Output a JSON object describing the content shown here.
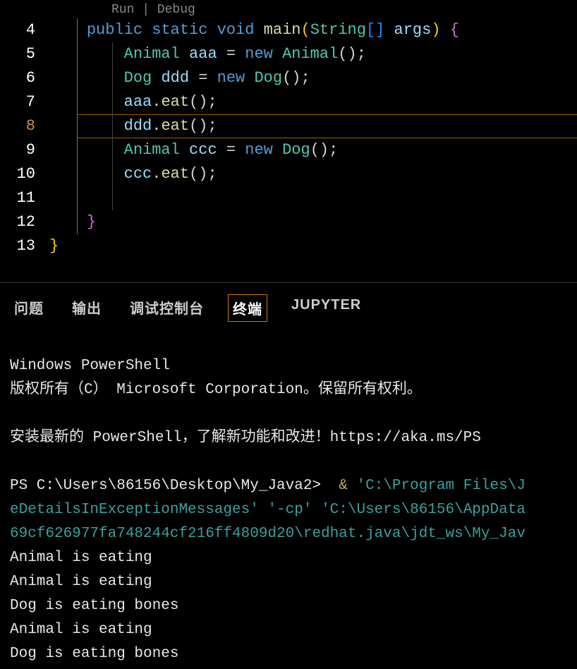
{
  "codelens": {
    "run": "Run",
    "sep": " | ",
    "debug": "Debug"
  },
  "lines": {
    "l4_num": "4",
    "l4": {
      "kw_public": "public",
      "kw_static": "static",
      "kw_void": "void",
      "fn": "main",
      "type": "String",
      "var": "args"
    },
    "l5_num": "5",
    "l5": {
      "type": "Animal",
      "var": "aaa",
      "new": "new",
      "ctor": "Animal"
    },
    "l6_num": "6",
    "l6": {
      "type": "Dog",
      "var": "ddd",
      "new": "new",
      "ctor": "Dog"
    },
    "l7_num": "7",
    "l7": {
      "var": "aaa",
      "fn": "eat"
    },
    "l8_num": "8",
    "l8": {
      "var": "ddd",
      "fn": "eat"
    },
    "l9_num": "9",
    "l9": {
      "type": "Animal",
      "var": "ccc",
      "new": "new",
      "ctor": "Dog"
    },
    "l10_num": "10",
    "l10": {
      "var": "ccc",
      "fn": "eat"
    },
    "l11_num": "11",
    "l12_num": "12",
    "l12_brace": "}",
    "l13_num": "13",
    "l13_brace": "}"
  },
  "tabs": {
    "problems": "问题",
    "output": "输出",
    "debug_console": "调试控制台",
    "terminal": "终端",
    "jupyter": "JUPYTER"
  },
  "terminal": {
    "l1": "Windows PowerShell",
    "l2": "版权所有（C） Microsoft Corporation。保留所有权利。",
    "l3": "",
    "l4": "安装最新的 PowerShell，了解新功能和改进！https://aka.ms/PS",
    "l5": "",
    "l6_prompt": "PS C:\\Users\\86156\\Desktop\\My_Java2> ",
    "l6_amp": " & ",
    "l6_cmd": "'C:\\Program Files\\J",
    "l7_cmd": "eDetailsInExceptionMessages' '-cp' 'C:\\Users\\86156\\AppData",
    "l8_cmd": "69cf626977fa748244cf216ff4809d20\\redhat.java\\jdt_ws\\My_Jav",
    "l9": "Animal is eating",
    "l10": "Animal is eating",
    "l11": "Dog is eating bones",
    "l12": "Animal is eating",
    "l13": "Dog is eating bones"
  }
}
